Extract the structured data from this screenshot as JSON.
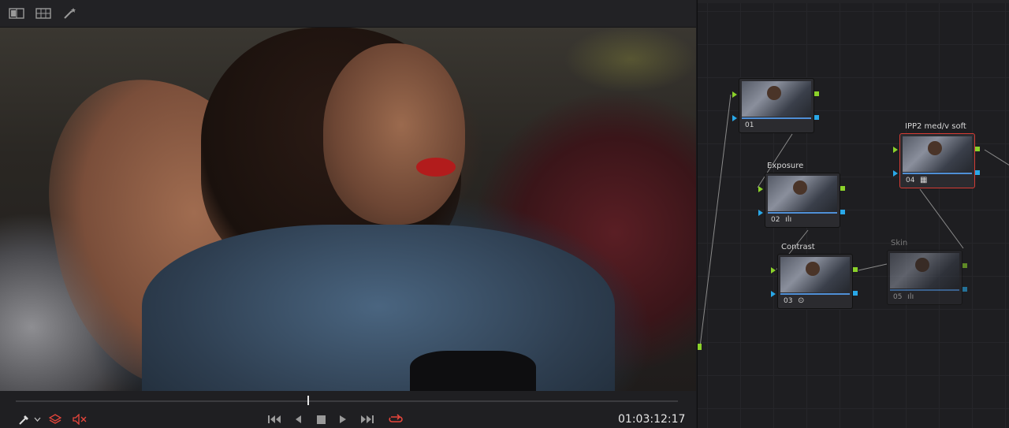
{
  "viewer_toolbar": {
    "icons": [
      "split-screen-icon",
      "gallery-icon",
      "magic-wand-icon"
    ]
  },
  "transport": {
    "timecode": "01:03:12:17",
    "playhead_fraction": 0.44,
    "icons": [
      "picker-icon",
      "chevron-down-icon",
      "layers-icon",
      "mute-icon",
      "skip-start-icon",
      "step-back-icon",
      "stop-icon",
      "play-icon",
      "skip-end-icon",
      "loop-icon"
    ]
  },
  "nodes": [
    {
      "number": "01",
      "label": "",
      "icon": ""
    },
    {
      "number": "02",
      "label": "Exposure",
      "icon": "ılı"
    },
    {
      "number": "03",
      "label": "Contrast",
      "icon": "⊙"
    },
    {
      "number": "04",
      "label": "IPP2 med/v soft",
      "icon": "▦"
    },
    {
      "number": "05",
      "label": "Skin",
      "icon": "ılı"
    }
  ],
  "colors": {
    "accent_blue": "#29a8e8",
    "accent_green": "#8bd22a",
    "selected_red": "#d53b34",
    "loop_red": "#e5453b"
  }
}
